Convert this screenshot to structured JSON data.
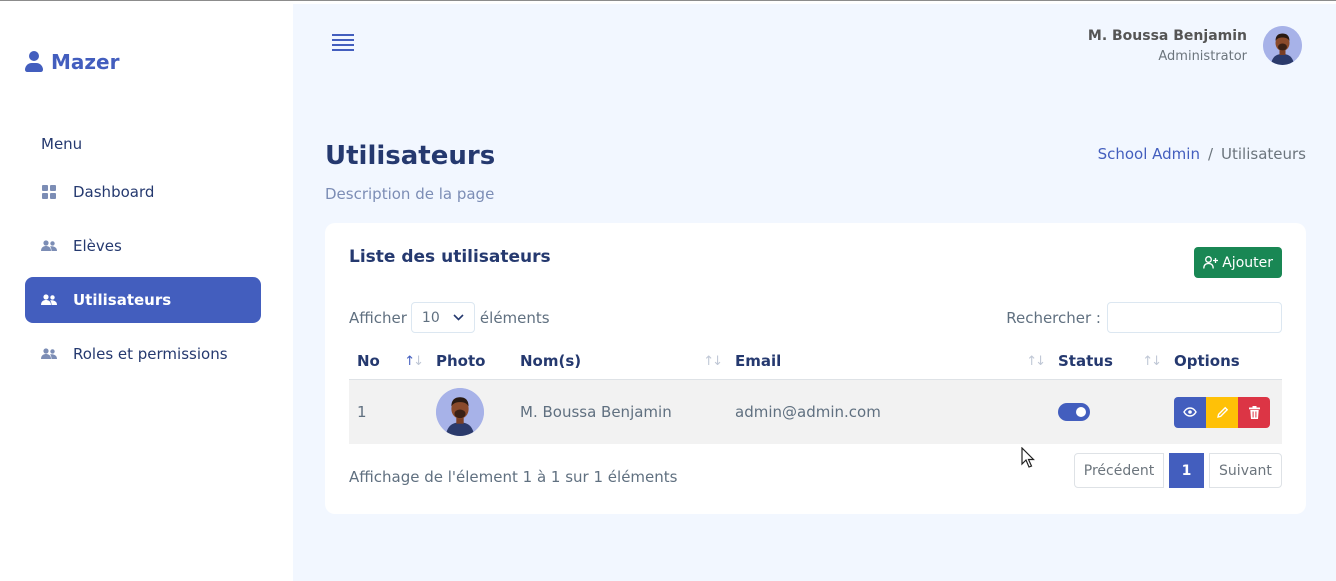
{
  "app": {
    "brand": "Mazer"
  },
  "sidebar": {
    "menu_title": "Menu",
    "items": [
      {
        "label": "Dashboard",
        "icon": "grid-icon",
        "active": false
      },
      {
        "label": "Elèves",
        "icon": "users-icon",
        "active": false
      },
      {
        "label": "Utilisateurs",
        "icon": "users-icon",
        "active": true
      },
      {
        "label": "Roles et permissions",
        "icon": "users-icon",
        "active": false
      }
    ]
  },
  "header": {
    "user_name": "M. Boussa Benjamin",
    "user_role": "Administrator"
  },
  "page": {
    "title": "Utilisateurs",
    "description": "Description de la page",
    "breadcrumb": {
      "parent": "School Admin",
      "separator": "/",
      "current": "Utilisateurs"
    }
  },
  "card": {
    "title": "Liste des utilisateurs",
    "add_label": "Ajouter",
    "length": {
      "prefix": "Afficher",
      "value": "10",
      "suffix": "éléments"
    },
    "search": {
      "label": "Rechercher :",
      "value": ""
    },
    "columns": [
      "No",
      "Photo",
      "Nom(s)",
      "Email",
      "Status",
      "Options"
    ],
    "rows": [
      {
        "no": "1",
        "name": "M. Boussa Benjamin",
        "email": "admin@admin.com",
        "status_on": true
      }
    ],
    "info": "Affichage de l'élement 1 à 1 sur 1 éléments",
    "pagination": {
      "prev": "Précédent",
      "page": "1",
      "next": "Suivant"
    }
  },
  "colors": {
    "primary": "#435ebe",
    "success": "#198754",
    "warning": "#ffc107",
    "danger": "#dc3545"
  }
}
